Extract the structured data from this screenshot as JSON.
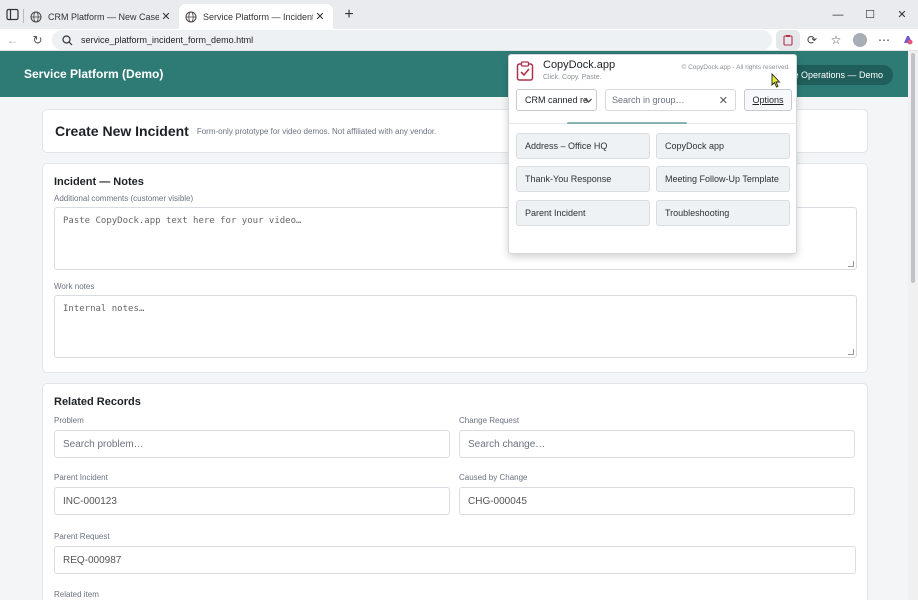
{
  "browser": {
    "tabs": [
      {
        "title": "CRM Platform — New Case/Lead",
        "active": false
      },
      {
        "title": "Service Platform — Incident Form",
        "active": true
      }
    ],
    "new_tab_label": "+",
    "url": "service_platform_incident_form_demo.html",
    "window": {
      "minimize": "—",
      "maximize": "☐",
      "close": "✕"
    },
    "toolbar_icons": [
      "copydock-extension-icon",
      "refresh-extension-icon",
      "favorites-icon",
      "profile-avatar",
      "more-menu-icon",
      "copilot-icon"
    ]
  },
  "app": {
    "title": "Service Platform (Demo)",
    "pill": "ce Operations — Demo",
    "accent": "#2e7b76"
  },
  "page_header": {
    "title": "Create New Incident",
    "subtitle": "Form-only prototype for video demos. Not affiliated with any vendor."
  },
  "notes": {
    "heading": "Incident — Notes",
    "additional_label": "Additional comments (customer visible)",
    "additional_placeholder": "Paste CopyDock.app text here for your video…",
    "work_label": "Work notes",
    "work_placeholder": "Internal notes…"
  },
  "related": {
    "heading": "Related Records",
    "problem_label": "Problem",
    "problem_placeholder": "Search problem…",
    "change_label": "Change Request",
    "change_placeholder": "Search change…",
    "parent_incident_label": "Parent Incident",
    "parent_incident_value": "INC-000123",
    "caused_by_label": "Caused by Change",
    "caused_by_value": "CHG-000045",
    "parent_request_label": "Parent Request",
    "parent_request_value": "REQ-000987",
    "related_item_label": "Related item"
  },
  "popup": {
    "name": "CopyDock.app",
    "tagline": "Click. Copy. Paste.",
    "copyright": "© CopyDock.app - All rights reserved.",
    "group_select": "CRM canned re",
    "search_placeholder": "Search in group…",
    "clear": "✕",
    "options": "Options",
    "snippets": [
      "Address – Office HQ",
      "CopyDock app",
      "Thank-You Response",
      "Meeting Follow-Up Template",
      "Parent Incident",
      "Troubleshooting"
    ]
  }
}
